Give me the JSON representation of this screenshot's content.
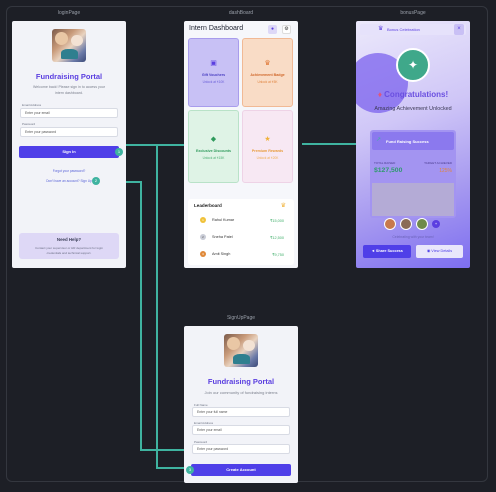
{
  "frames": {
    "login": "loginPage",
    "dashboard": "dashBoard",
    "bonus": "bonusPage",
    "signup": "SignUpPage"
  },
  "login": {
    "title": "Fundraising Portal",
    "subtitle_line1": "Welcome back! Please sign in to access your",
    "subtitle_line2": "intern dashboard.",
    "email_label": "Email Address",
    "email_placeholder": "Enter your email",
    "password_label": "Password",
    "password_placeholder": "Enter your password",
    "signin_button": "Sign In",
    "forgot_link": "Forgot your password?",
    "signup_link": "Don't have an account? Sign Up",
    "help_title": "Need Help?",
    "help_text_line1": "Contact your supervisor or HR department for login",
    "help_text_line2": "credentials and technical support.",
    "marker_1": "1",
    "marker_2": "2"
  },
  "dashboard": {
    "title": "Intern Dashboard",
    "icons": {
      "bell": "bell-icon",
      "gear": "gear-icon"
    },
    "tiles": [
      {
        "title": "Gift Vouchers",
        "sub": "Unlock at ₹10K",
        "icon": "gift-icon"
      },
      {
        "title": "Achievement Badge",
        "sub": "Unlock at ₹5K",
        "icon": "trophy-icon"
      },
      {
        "title": "Exclusive Discounts",
        "sub": "Unlock at ₹15K",
        "icon": "tag-icon"
      },
      {
        "title": "Premium Rewards",
        "sub": "Unlock at ₹20K",
        "icon": "star-icon"
      }
    ],
    "leaderboard_title": "Leaderboard",
    "leaderboard": [
      {
        "rank": "1",
        "name": "Rahul Kumar",
        "amount": "₹15,000"
      },
      {
        "rank": "2",
        "name": "Sneha Patel",
        "amount": "₹12,500"
      },
      {
        "rank": "3",
        "name": "Amit Singh",
        "amount": "₹9,750"
      }
    ]
  },
  "bonus": {
    "header": "Bonus Celebration",
    "close": "×",
    "congrats": "Congratulations!",
    "subtitle": "Amazing Achievement Unlocked",
    "card_title": "Fund Raising Success",
    "total_raised_label": "TOTAL RAISED",
    "total_raised": "$127,500",
    "target_label": "TARGET ACHIEVED",
    "target_pct": "125%",
    "celebrating_text": "Celebrating with your team!",
    "share_button": "Share Success",
    "view_button": "View Details"
  },
  "signup": {
    "title": "Fundraising Portal",
    "subtitle": "Join our community of fundraising interns",
    "name_label": "Full Name",
    "name_placeholder": "Enter your full name",
    "email_label": "Email Address",
    "email_placeholder": "Enter your email",
    "password_label": "Password",
    "password_placeholder": "Enter your password",
    "create_button": "Create Account",
    "marker_3": "3"
  },
  "colors": {
    "background": "#1d1f26",
    "accent": "#4f3fe8",
    "connector": "#3fb3a0",
    "brand_title": "#5b3fe0"
  }
}
